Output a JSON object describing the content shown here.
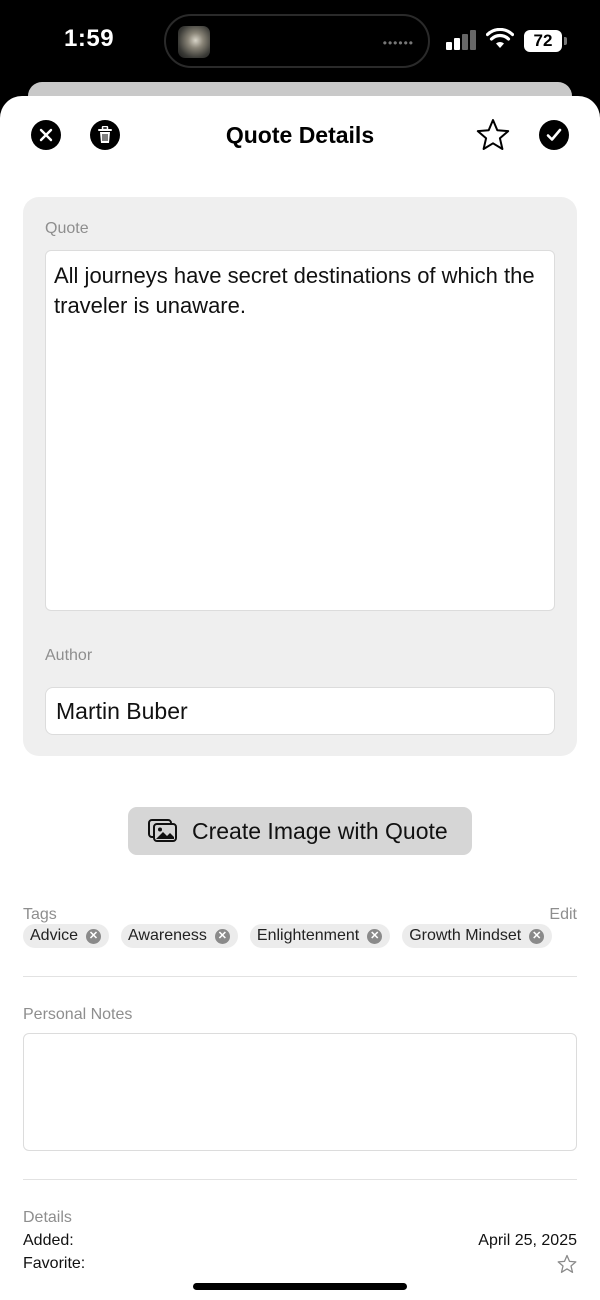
{
  "status_bar": {
    "time": "1:59",
    "battery": "72",
    "island_dots": "••••••"
  },
  "header": {
    "title": "Quote Details",
    "icons": [
      "close-icon",
      "trash-icon",
      "star-icon",
      "checkmark-icon"
    ]
  },
  "quote_card": {
    "quote_label": "Quote",
    "quote_text": "All journeys have secret destinations of which the traveler is unaware.",
    "author_label": "Author",
    "author_value": "Martin Buber"
  },
  "create_image_button": {
    "label": "Create Image with Quote",
    "icon": "photo-stack-icon"
  },
  "tags": {
    "label": "Tags",
    "edit_label": "Edit",
    "items": [
      "Advice",
      "Awareness",
      "Enlightenment",
      "Growth Mindset"
    ]
  },
  "notes": {
    "label": "Personal Notes",
    "value": ""
  },
  "details": {
    "label": "Details",
    "added_label": "Added:",
    "added_value": "April 25, 2025",
    "favorite_label": "Favorite:",
    "favorite_icon": "star-outline-icon"
  },
  "colors": {
    "accent": "#000000",
    "card_bg": "#efefef",
    "muted_text": "#8e8e8e"
  }
}
